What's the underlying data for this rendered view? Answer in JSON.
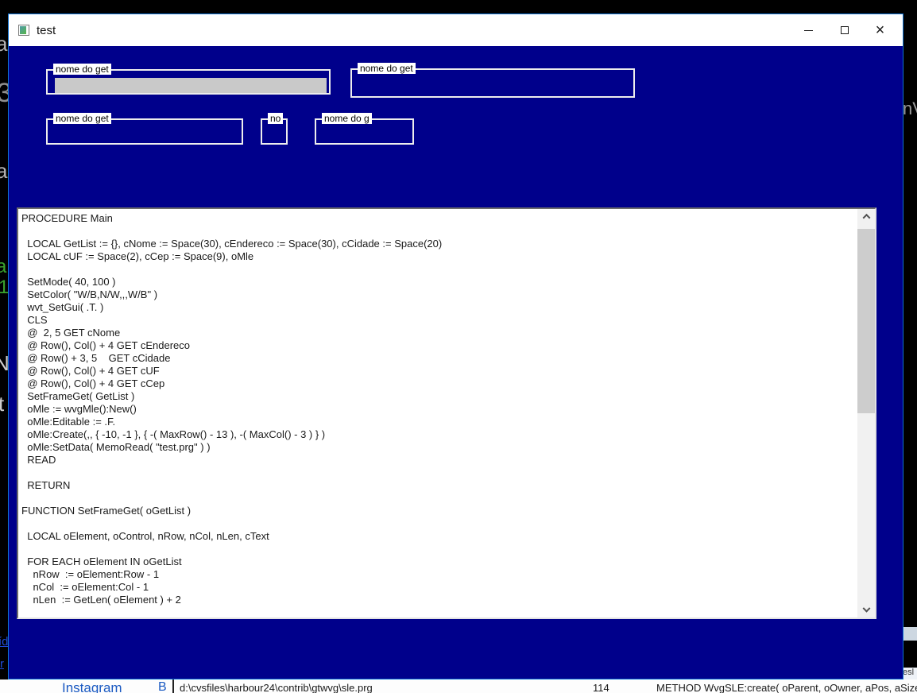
{
  "window": {
    "title": "test",
    "close_glyph": "×"
  },
  "form": {
    "group_boxes": [
      {
        "label": "nome do get",
        "field_filled": true
      },
      {
        "label": "nome do get",
        "field_filled": false
      },
      {
        "label": "nome do get",
        "field_filled": false
      },
      {
        "label": "no",
        "field_filled": false
      },
      {
        "label": "nome do g",
        "field_filled": false
      }
    ]
  },
  "editor": {
    "code_lines": [
      "PROCEDURE Main",
      "",
      "  LOCAL GetList := {}, cNome := Space(30), cEndereco := Space(30), cCidade := Space(20)",
      "  LOCAL cUF := Space(2), cCep := Space(9), oMle",
      "",
      "  SetMode( 40, 100 )",
      "  SetColor( \"W/B,N/W,,,W/B\" )",
      "  wvt_SetGui( .T. )",
      "  CLS",
      "  @  2, 5 GET cNome",
      "  @ Row(), Col() + 4 GET cEndereco",
      "  @ Row() + 3, 5    GET cCidade",
      "  @ Row(), Col() + 4 GET cUF",
      "  @ Row(), Col() + 4 GET cCep",
      "  SetFrameGet( GetList )",
      "  oMle := wvgMle():New()",
      "  oMle:Editable := .F.",
      "  oMle:Create(,, { -10, -1 }, { -( MaxRow() - 13 ), -( MaxCol() - 3 ) } )",
      "  oMle:SetData( MemoRead( \"test.prg\" ) )",
      "  READ",
      "",
      "  RETURN",
      "",
      "FUNCTION SetFrameGet( oGetList )",
      "",
      "  LOCAL oElement, oControl, nRow, nCol, nLen, cText",
      "",
      "  FOR EACH oElement IN oGetList",
      "    nRow  := oElement:Row - 1",
      "    nCol  := oElement:Col - 1",
      "    nLen  := GetLen( oElement ) + 2"
    ]
  },
  "background": {
    "left_fragments": [
      "a",
      "3",
      "a",
      "a",
      "1",
      "N",
      "t"
    ],
    "right_fragment": "nV",
    "link_fragments": [
      "íd",
      "r"
    ],
    "bottom_bar": {
      "instagram": "Instagram",
      "b_label": "B",
      "file_path": "d:\\cvsfiles\\harbour24\\contrib\\gtwvg\\sle.prg",
      "line_number": "114",
      "method_line": "METHOD WvgSLE:create( oParent, oOwner, aPos, aSize, aPr",
      "esl": "esl"
    }
  },
  "colors": {
    "window_bg": "#00008B",
    "window_border": "#1173d4",
    "titlebar_bg": "#ffffff",
    "frame_border": "#ededed",
    "get_field_fill": "#c9c9c9",
    "link_blue": "#1f4bd8"
  }
}
